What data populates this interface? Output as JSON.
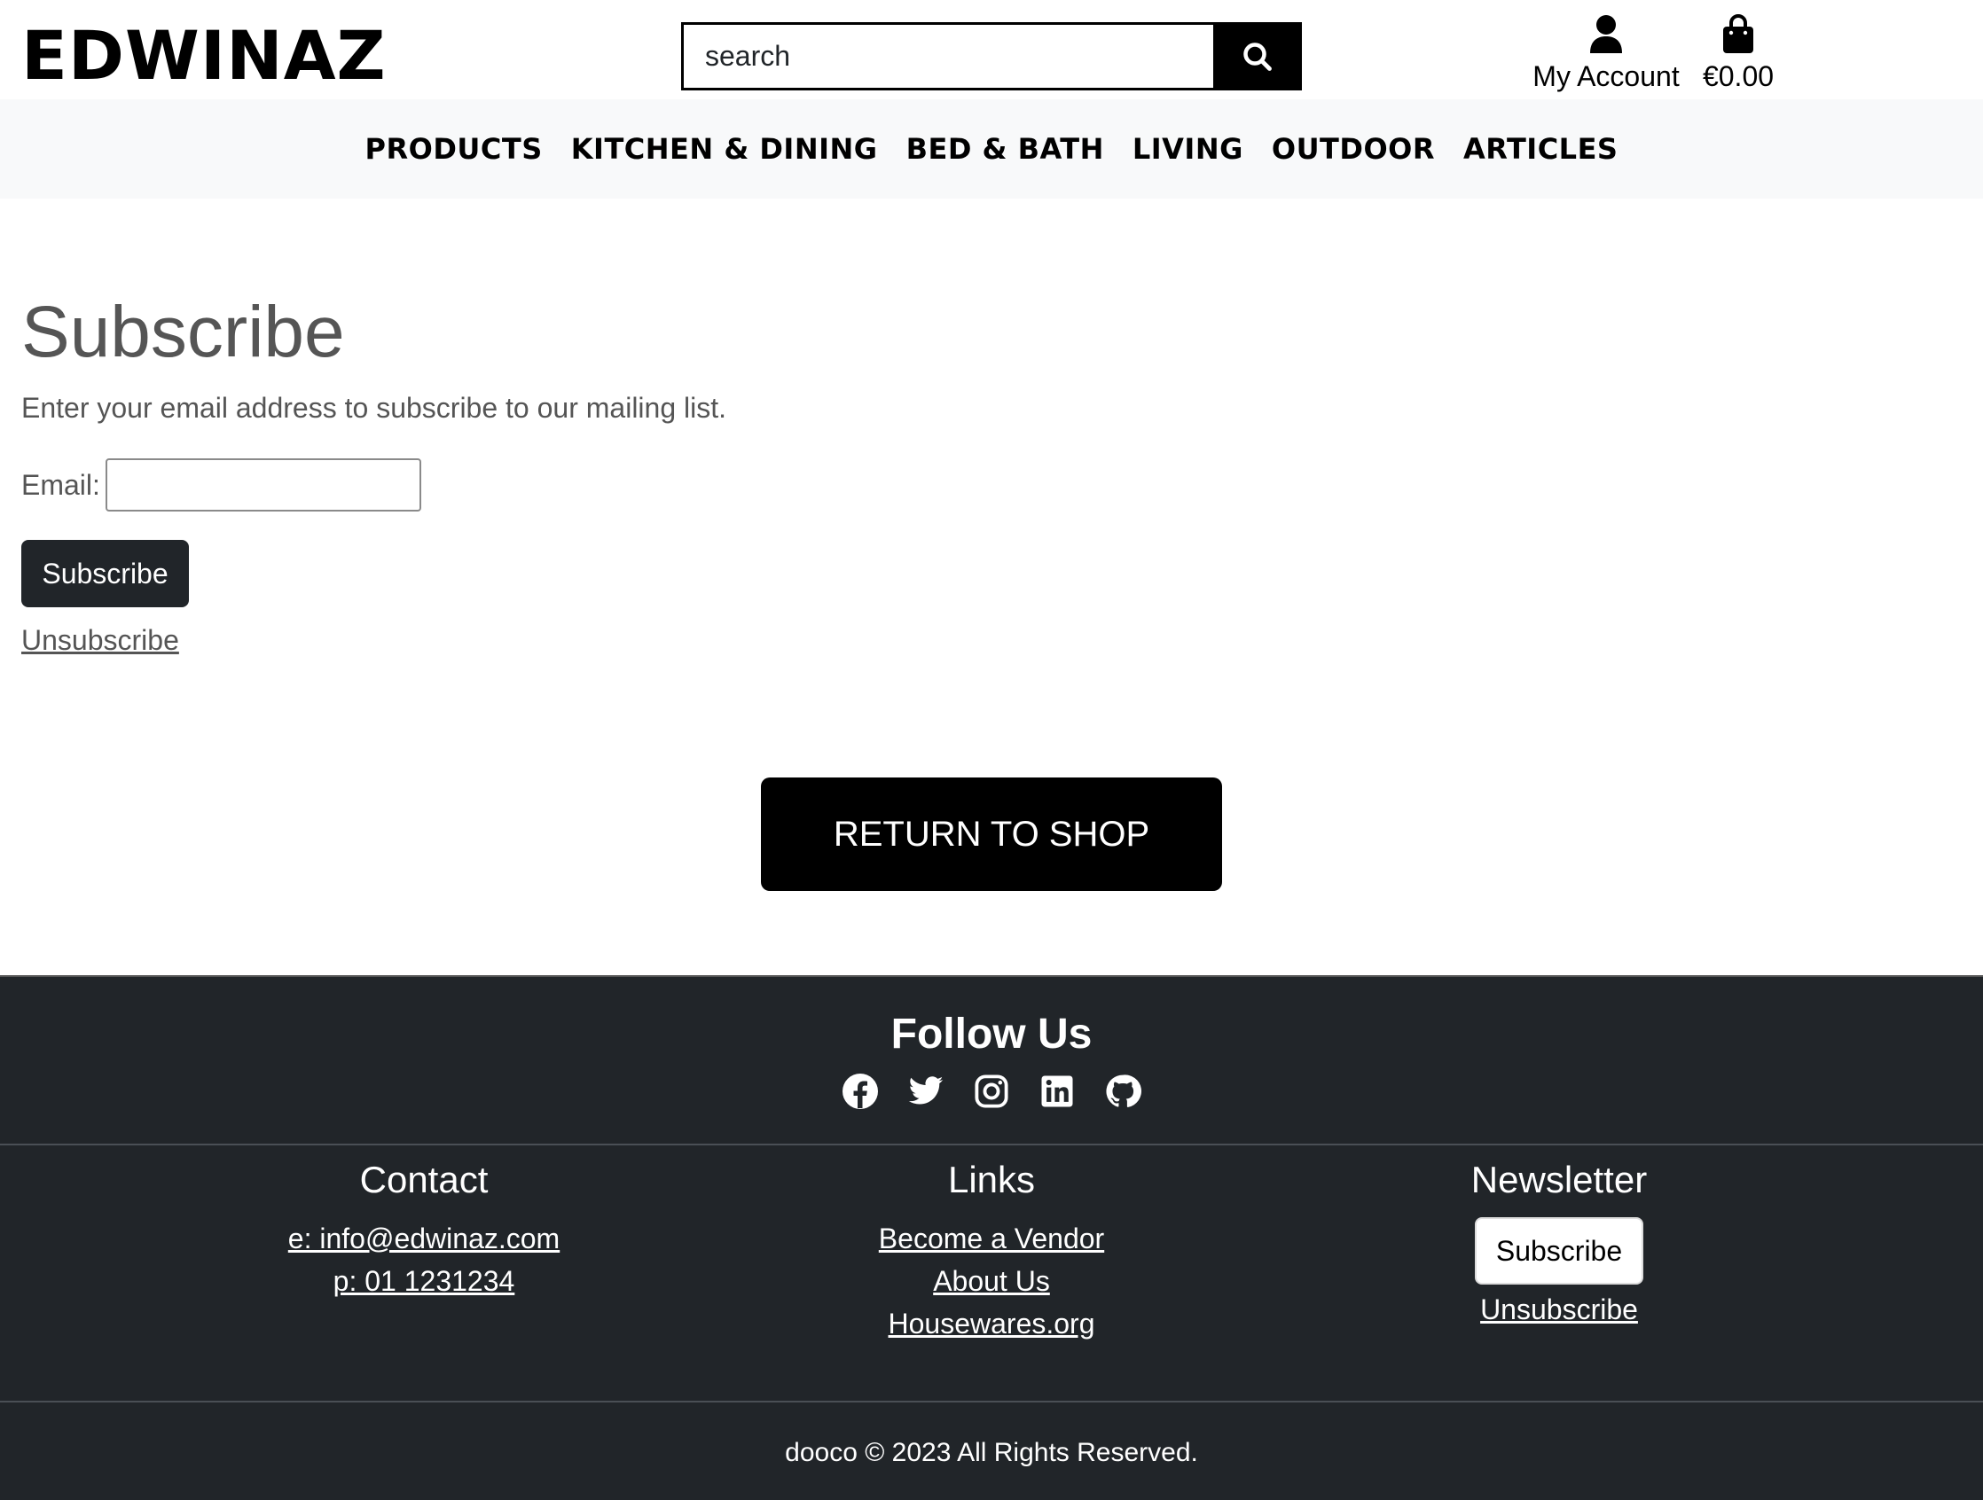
{
  "header": {
    "logo": "EDWINAZ",
    "search": {
      "placeholder": "search",
      "icon": "search-icon"
    },
    "account_label": "My Account",
    "cart_total": "€0.00"
  },
  "nav": {
    "items": [
      {
        "label": "PRODUCTS"
      },
      {
        "label": "KITCHEN & DINING"
      },
      {
        "label": "BED & BATH"
      },
      {
        "label": "LIVING"
      },
      {
        "label": "OUTDOOR"
      },
      {
        "label": "ARTICLES"
      }
    ]
  },
  "main": {
    "title": "Subscribe",
    "description": "Enter your email address to subscribe to our mailing list.",
    "email_label": "Email:",
    "email_value": "",
    "subscribe_label": "Subscribe",
    "unsubscribe_label": "Unsubscribe",
    "return_label": "RETURN TO SHOP"
  },
  "footer": {
    "follow_title": "Follow Us",
    "social_icons": [
      "facebook-icon",
      "twitter-icon",
      "instagram-icon",
      "linkedin-icon",
      "github-icon"
    ],
    "contact": {
      "title": "Contact",
      "email": "e: info@edwinaz.com",
      "phone": "p: 01 1231234"
    },
    "links": {
      "title": "Links",
      "items": [
        {
          "label": "Become a Vendor"
        },
        {
          "label": "About Us"
        },
        {
          "label": "Housewares.org"
        }
      ]
    },
    "newsletter": {
      "title": "Newsletter",
      "subscribe_label": "Subscribe",
      "unsubscribe_label": "Unsubscribe"
    },
    "copyright": "dooco © 2023 All Rights Reserved."
  },
  "colors": {
    "nav_bg": "#f8f9fa",
    "footer_bg": "#212529",
    "primary_btn": "#212529",
    "black": "#000000"
  }
}
